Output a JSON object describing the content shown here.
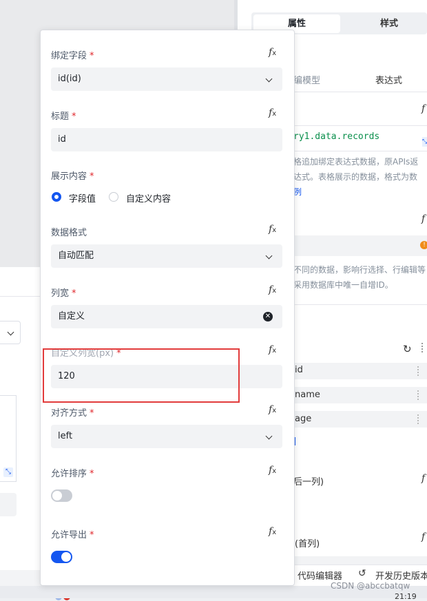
{
  "right_panel": {
    "tabs": [
      {
        "label": "属性"
      },
      {
        "label": "样式"
      }
    ],
    "partial_model_label": "编模型",
    "expression_tab": "表达式",
    "code_snippet": "ry1.data.records",
    "help_line1": "格追加绑定表达式数据，原APIs返",
    "help_line2": "达式。表格展示的数据，格式为数",
    "help_link": "例",
    "row_key_line1": "不同的数据，影响行选择、行编辑等",
    "row_key_line2": "采用数据库中唯一自增ID。",
    "columns": [
      {
        "label": "id"
      },
      {
        "label": "name"
      },
      {
        "label": "age"
      }
    ],
    "last_col_label": "后一列)",
    "first_col_label": "(首列)",
    "footer_code_editor": "代码编辑器",
    "footer_history": "开发历史版本"
  },
  "watermark": "CSDN @abccbatqw",
  "clock": "21:19",
  "form": {
    "bind_field": {
      "label": "绑定字段",
      "value": "id(id)"
    },
    "title": {
      "label": "标题",
      "value": "id"
    },
    "display_content": {
      "label": "展示内容",
      "option_field_value": "字段值",
      "option_custom": "自定义内容"
    },
    "data_format": {
      "label": "数据格式",
      "value": "自动匹配"
    },
    "col_width": {
      "label": "列宽",
      "value": "自定义"
    },
    "custom_width": {
      "label": "自定义列宽(px)",
      "value": "120"
    },
    "align": {
      "label": "对齐方式",
      "value": "left"
    },
    "allow_sort": {
      "label": "允许排序",
      "state": "off"
    },
    "allow_export": {
      "label": "允许导出",
      "state": "on"
    },
    "required_mark": "*",
    "fx_symbol": "f",
    "fx_sub": "x"
  },
  "colors": {
    "accent": "#1456f0",
    "required": "#e0262b",
    "highlight_box": "#e23b3b",
    "link": "#1456f0"
  }
}
